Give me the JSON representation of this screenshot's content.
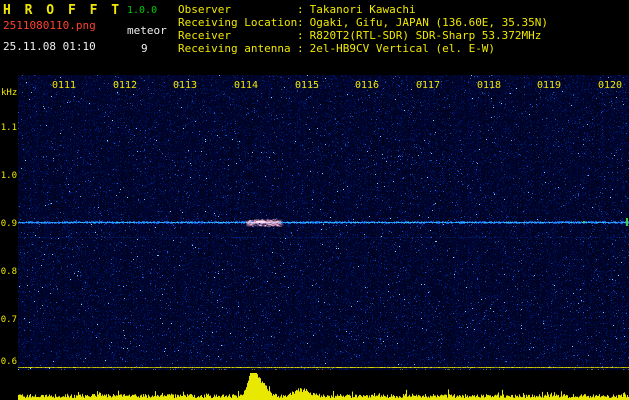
{
  "colors": {
    "yellow": "#f0e800",
    "green": "#00cc00",
    "red": "#ff4030",
    "white": "#f0f0f0",
    "spectrogram_bg": "#000028",
    "carrier_cyan": "#50c8ff",
    "echo_pink": "#ffc0d8",
    "marker_yellow": "#d0d000",
    "amplitude_yellow": "#e8e800"
  },
  "header": {
    "app_title": "H R O F F T",
    "version": "1.0.0",
    "filename": "2511080110.png",
    "mode_label": "meteor",
    "datetime": "25.11.08 01:10",
    "count": "9",
    "separator": ":",
    "info": [
      {
        "label": "Observer",
        "value": "Takanori Kawachi"
      },
      {
        "label": "Receiving Location",
        "value": "Ogaki, Gifu, JAPAN (136.60E, 35.35N)"
      },
      {
        "label": "Receiver",
        "value": "R820T2(RTL-SDR) SDR-Sharp 53.372MHz"
      },
      {
        "label": "Receiving antenna",
        "value": "2el-HB9CV Vertical (el. E-W)"
      }
    ]
  },
  "axis": {
    "unit": "kHz",
    "freq_ticks": [
      "1.1",
      "1.0",
      "0.9",
      "0.8",
      "0.7",
      "0.6"
    ],
    "time_ticks": [
      "0111",
      "0112",
      "0113",
      "0114",
      "0115",
      "0116",
      "0117",
      "0118",
      "0119",
      "0120"
    ]
  },
  "chart_data": {
    "type": "heatmap",
    "description": "Radio meteor observation spectrogram (HROFFT) with amplitude strip below",
    "x_ticks": [
      "0111",
      "0112",
      "0113",
      "0114",
      "0115",
      "0116",
      "0117",
      "0118",
      "0119",
      "0120"
    ],
    "y_unit": "kHz",
    "y_ticks": [
      1.1,
      1.0,
      0.9,
      0.8,
      0.7,
      0.6
    ],
    "y_range_khz": [
      0.6,
      1.2
    ],
    "background": "dark blue noise field",
    "features": [
      {
        "name": "carrier-line",
        "freq_khz": 0.91,
        "span": "full width",
        "color": "#50c8ff"
      },
      {
        "name": "meteor-echo",
        "time_tick": "0114",
        "freq_khz": 0.91,
        "color": "#ffc0d8"
      },
      {
        "name": "horizontal-marker",
        "freq_khz": 0.61,
        "span": "full width",
        "color": "#d0d000"
      }
    ],
    "amplitude_strip": {
      "color": "#e8e800",
      "baseline": "noisy low-level signal across full width",
      "peak_time_tick": "0114"
    }
  }
}
